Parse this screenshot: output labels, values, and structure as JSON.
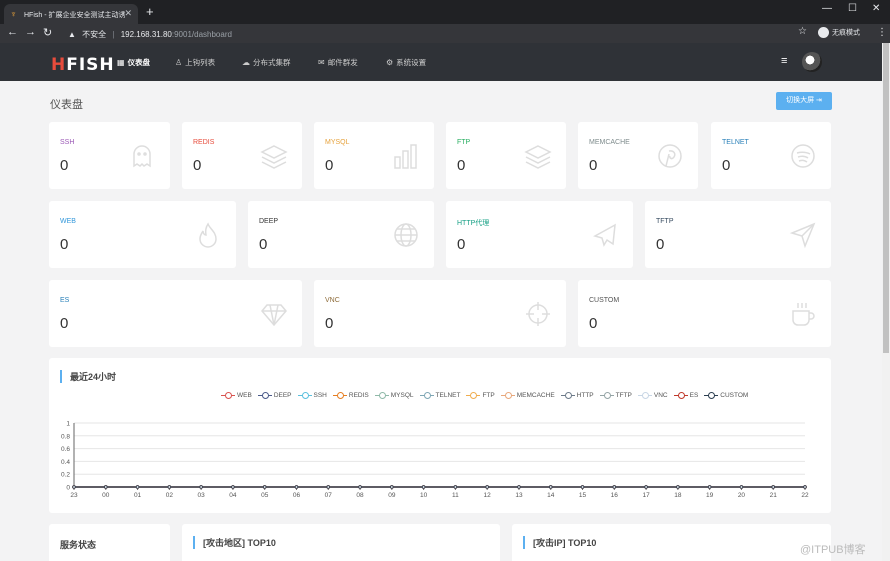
{
  "browser": {
    "tab_title": "HFish - 扩展企业安全测试主动诱",
    "close_glyph": "✕",
    "new_tab_glyph": "+",
    "window_controls": [
      "—",
      "☐",
      "✕"
    ],
    "not_secure": "不安全",
    "host": "192.168.31.80",
    "path": ":9001/dashboard",
    "incognito_label": "无痕模式"
  },
  "app": {
    "logo_h": "H",
    "logo_rest": "FISH",
    "menu": [
      {
        "label": "仪表盘",
        "icon": "dashboard-icon",
        "active": true
      },
      {
        "label": "上钩列表",
        "icon": "user-icon",
        "active": false
      },
      {
        "label": "分布式集群",
        "icon": "cloud-icon",
        "active": false
      },
      {
        "label": "邮件群发",
        "icon": "mail-icon",
        "active": false
      },
      {
        "label": "系统设置",
        "icon": "gear-icon",
        "active": false
      }
    ]
  },
  "page": {
    "title": "仪表盘",
    "switch_button": "切换大屏 ⇥"
  },
  "cards": [
    {
      "label": "SSH",
      "value": "0",
      "color": "#9b59b6",
      "icon": "ghost-icon"
    },
    {
      "label": "REDIS",
      "value": "0",
      "color": "#e74c3c",
      "icon": "layers-icon"
    },
    {
      "label": "MYSQL",
      "value": "0",
      "color": "#e6a23c",
      "icon": "bar-chart-icon"
    },
    {
      "label": "FTP",
      "value": "0",
      "color": "#27ae60",
      "icon": "layers-icon"
    },
    {
      "label": "MEMCACHE",
      "value": "0",
      "color": "#7f8c8d",
      "icon": "pinterest-icon"
    },
    {
      "label": "TELNET",
      "value": "0",
      "color": "#2980b9",
      "icon": "spotify-icon"
    },
    {
      "label": "WEB",
      "value": "0",
      "color": "#3498db",
      "icon": "fire-icon"
    },
    {
      "label": "DEEP",
      "value": "0",
      "color": "#333333",
      "icon": "globe-icon"
    },
    {
      "label": "HTTP代理",
      "value": "0",
      "color": "#16a085",
      "icon": "plane-icon"
    },
    {
      "label": "TFTP",
      "value": "0",
      "color": "#34495e",
      "icon": "send-icon"
    },
    {
      "label": "ES",
      "value": "0",
      "color": "#2980b9",
      "icon": "diamond-icon"
    },
    {
      "label": "VNC",
      "value": "0",
      "color": "#8e6c3a",
      "icon": "crosshair-icon"
    },
    {
      "label": "CUSTOM",
      "value": "0",
      "color": "#555555",
      "icon": "coffee-icon"
    }
  ],
  "chart_panel": {
    "title": "最近24小时"
  },
  "chart_data": {
    "type": "line",
    "title": "最近24小时",
    "categories": [
      "23",
      "00",
      "01",
      "02",
      "03",
      "04",
      "05",
      "06",
      "07",
      "08",
      "09",
      "10",
      "11",
      "12",
      "13",
      "14",
      "15",
      "16",
      "17",
      "18",
      "19",
      "20",
      "21",
      "22"
    ],
    "ylim": [
      0,
      1
    ],
    "yticks": [
      "0",
      "0.2",
      "0.4",
      "0.6",
      "0.8",
      "1"
    ],
    "series": [
      {
        "name": "WEB",
        "color": "#d9534f",
        "values": [
          0,
          0,
          0,
          0,
          0,
          0,
          0,
          0,
          0,
          0,
          0,
          0,
          0,
          0,
          0,
          0,
          0,
          0,
          0,
          0,
          0,
          0,
          0,
          0
        ]
      },
      {
        "name": "DEEP",
        "color": "#4a5a8a",
        "values": [
          0,
          0,
          0,
          0,
          0,
          0,
          0,
          0,
          0,
          0,
          0,
          0,
          0,
          0,
          0,
          0,
          0,
          0,
          0,
          0,
          0,
          0,
          0,
          0
        ]
      },
      {
        "name": "SSH",
        "color": "#5bc0de",
        "values": [
          0,
          0,
          0,
          0,
          0,
          0,
          0,
          0,
          0,
          0,
          0,
          0,
          0,
          0,
          0,
          0,
          0,
          0,
          0,
          0,
          0,
          0,
          0,
          0
        ]
      },
      {
        "name": "REDIS",
        "color": "#e67e22",
        "values": [
          0,
          0,
          0,
          0,
          0,
          0,
          0,
          0,
          0,
          0,
          0,
          0,
          0,
          0,
          0,
          0,
          0,
          0,
          0,
          0,
          0,
          0,
          0,
          0
        ]
      },
      {
        "name": "MYSQL",
        "color": "#8fb9a8",
        "values": [
          0,
          0,
          0,
          0,
          0,
          0,
          0,
          0,
          0,
          0,
          0,
          0,
          0,
          0,
          0,
          0,
          0,
          0,
          0,
          0,
          0,
          0,
          0,
          0
        ]
      },
      {
        "name": "TELNET",
        "color": "#7fa7b5",
        "values": [
          0,
          0,
          0,
          0,
          0,
          0,
          0,
          0,
          0,
          0,
          0,
          0,
          0,
          0,
          0,
          0,
          0,
          0,
          0,
          0,
          0,
          0,
          0,
          0
        ]
      },
      {
        "name": "FTP",
        "color": "#f0ad4e",
        "values": [
          0,
          0,
          0,
          0,
          0,
          0,
          0,
          0,
          0,
          0,
          0,
          0,
          0,
          0,
          0,
          0,
          0,
          0,
          0,
          0,
          0,
          0,
          0,
          0
        ]
      },
      {
        "name": "MEMCACHE",
        "color": "#e8a87c",
        "values": [
          0,
          0,
          0,
          0,
          0,
          0,
          0,
          0,
          0,
          0,
          0,
          0,
          0,
          0,
          0,
          0,
          0,
          0,
          0,
          0,
          0,
          0,
          0,
          0
        ]
      },
      {
        "name": "HTTP",
        "color": "#6c7a89",
        "values": [
          0,
          0,
          0,
          0,
          0,
          0,
          0,
          0,
          0,
          0,
          0,
          0,
          0,
          0,
          0,
          0,
          0,
          0,
          0,
          0,
          0,
          0,
          0,
          0
        ]
      },
      {
        "name": "TFTP",
        "color": "#95a5a6",
        "values": [
          0,
          0,
          0,
          0,
          0,
          0,
          0,
          0,
          0,
          0,
          0,
          0,
          0,
          0,
          0,
          0,
          0,
          0,
          0,
          0,
          0,
          0,
          0,
          0
        ]
      },
      {
        "name": "VNC",
        "color": "#c8d6e5",
        "values": [
          0,
          0,
          0,
          0,
          0,
          0,
          0,
          0,
          0,
          0,
          0,
          0,
          0,
          0,
          0,
          0,
          0,
          0,
          0,
          0,
          0,
          0,
          0,
          0
        ]
      },
      {
        "name": "ES",
        "color": "#c0392b",
        "values": [
          0,
          0,
          0,
          0,
          0,
          0,
          0,
          0,
          0,
          0,
          0,
          0,
          0,
          0,
          0,
          0,
          0,
          0,
          0,
          0,
          0,
          0,
          0,
          0
        ]
      },
      {
        "name": "CUSTOM",
        "color": "#2c3e50",
        "values": [
          0,
          0,
          0,
          0,
          0,
          0,
          0,
          0,
          0,
          0,
          0,
          0,
          0,
          0,
          0,
          0,
          0,
          0,
          0,
          0,
          0,
          0,
          0,
          0
        ]
      }
    ],
    "grid": true,
    "legend": "top-center"
  },
  "bottom_panels": {
    "service_status": "服务状态",
    "attack_region": "[攻击地区] TOP10",
    "attack_ip": "[攻击IP] TOP10"
  },
  "watermark": "@ITPUB博客"
}
